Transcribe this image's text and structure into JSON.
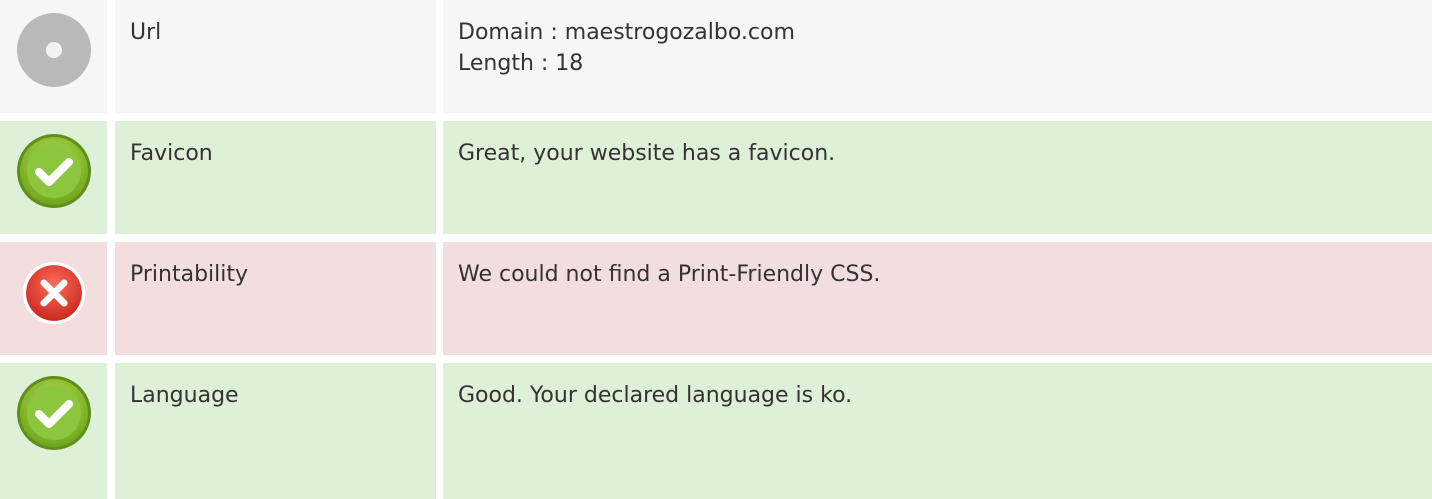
{
  "rows": [
    {
      "status": "neutral",
      "icon": "neutral-circle-icon",
      "label": "Url",
      "lines": [
        "Domain : maestrogozalbo.com",
        "Length : 18"
      ]
    },
    {
      "status": "good",
      "icon": "check-circle-icon",
      "label": "Favicon",
      "lines": [
        "Great, your website has a favicon."
      ]
    },
    {
      "status": "bad",
      "icon": "error-circle-icon",
      "label": "Printability",
      "lines": [
        "We could not find a Print-Friendly CSS."
      ]
    },
    {
      "status": "good",
      "icon": "check-circle-icon",
      "label": "Language",
      "lines": [
        "Good. Your declared language is ko."
      ]
    }
  ],
  "colors": {
    "neutral_bg": "#f6f6f6",
    "good_bg": "#dff0d8",
    "bad_bg": "#f2dede",
    "good_icon": "#8bc34a",
    "bad_icon": "#e53935",
    "neutral_icon": "#bdbdbd"
  }
}
